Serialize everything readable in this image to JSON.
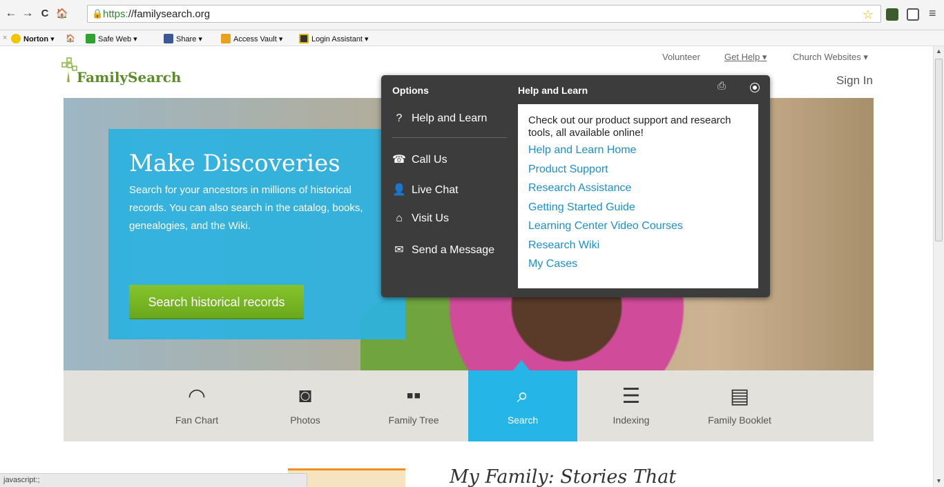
{
  "browser": {
    "back": "←",
    "forward": "→",
    "reload": "C",
    "home": "🏠",
    "url_scheme": "https:",
    "url_rest": "//familysearch.org",
    "menu": "≡"
  },
  "norton_toolbar": {
    "close": "×",
    "norton": "Norton",
    "safe_web": "Safe Web",
    "share": "Share",
    "access_vault": "Access Vault",
    "login_assistant": "Login Assistant"
  },
  "site": {
    "logo_text": "FamilySearch",
    "volunteer": "Volunteer",
    "get_help": "Get Help",
    "church_websites": "Church Websites",
    "sign_in": "Sign In"
  },
  "hero": {
    "title": "Make Discoveries",
    "text": "Search for your ancestors in millions of historical records. You can also search in the catalog, books, genealogies, and the Wiki.",
    "button": "Search historical records"
  },
  "popup": {
    "options_heading": "Options",
    "help_heading": "Help and Learn",
    "options": [
      {
        "icon": "?",
        "label": "Help and Learn"
      },
      {
        "icon": "☎",
        "label": "Call Us"
      },
      {
        "icon": "👤",
        "label": "Live Chat"
      },
      {
        "icon": "⌂",
        "label": "Visit Us"
      },
      {
        "icon": "✉",
        "label": "Send a Message"
      }
    ],
    "intro": "Check out our product support and research tools, all available online!",
    "links": [
      "Help and Learn Home",
      "Product Support",
      "Research Assistance",
      "Getting Started Guide",
      "Learning Center Video Courses",
      "Research Wiki",
      "My Cases"
    ]
  },
  "tools": [
    {
      "label": "Fan Chart",
      "icon": "◠"
    },
    {
      "label": "Photos",
      "icon": "◙"
    },
    {
      "label": "Family Tree",
      "icon": "▪▪"
    },
    {
      "label": "Search",
      "icon": "⌕"
    },
    {
      "label": "Indexing",
      "icon": "☰"
    },
    {
      "label": "Family Booklet",
      "icon": "▤"
    }
  ],
  "story_title": "My Family: Stories That",
  "status_bar": "javascript:;"
}
